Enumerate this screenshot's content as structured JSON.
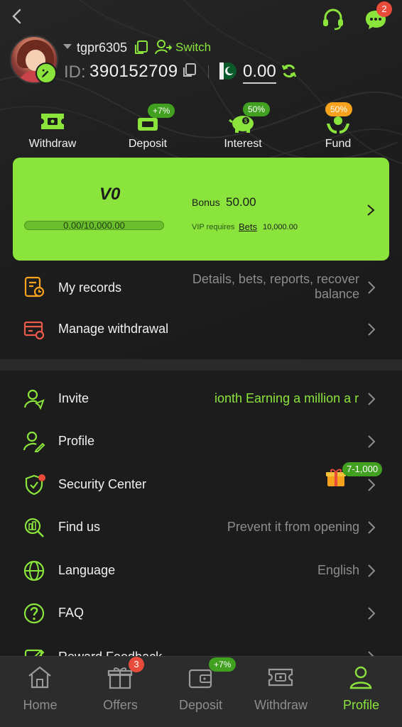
{
  "header": {
    "back_icon": "chevron-left-icon",
    "support_icon": "headset-icon",
    "messages_icon": "chat-icon",
    "messages_badge": "2",
    "username": "tgpr6305",
    "switch_label": "Switch",
    "id_label": "ID:",
    "user_id": "390152709",
    "balance": "0.00",
    "flag_icon": "pakistan-flag-icon",
    "refresh_icon": "refresh-icon"
  },
  "quick_actions": [
    {
      "label": "Withdraw",
      "icon": "withdraw-ticket-icon",
      "badge": ""
    },
    {
      "label": "Deposit",
      "icon": "deposit-icon",
      "badge": "+7%"
    },
    {
      "label": "Interest",
      "icon": "piggy-bank-icon",
      "badge": "50%"
    },
    {
      "label": "Fund",
      "icon": "fund-hands-icon",
      "badge": "50%"
    }
  ],
  "vip": {
    "level": "V0",
    "progress_text": "0.00/10,000.00",
    "progress_fraction": 0.0,
    "bonus_label": "Bonus",
    "bonus_value": "50.00",
    "requires_label": "VIP requires",
    "bets_label": "Bets",
    "requires_amount": "10,000.00"
  },
  "menu_top": [
    {
      "label": "My records",
      "value_line1": "Details, bets, reports, recover",
      "value_line2": "balance",
      "icon": "records-icon"
    },
    {
      "label": "Manage withdrawal",
      "value_line1": "",
      "value_line2": "",
      "icon": "manage-withdrawal-icon"
    }
  ],
  "menu_bottom": [
    {
      "label": "Invite",
      "value": "ionth  Earning a million a r",
      "icon": "invite-icon"
    },
    {
      "label": "Profile",
      "value": "",
      "icon": "profile-edit-icon"
    },
    {
      "label": "Security Center",
      "value": "",
      "icon": "shield-check-icon",
      "gift_badge": "7-1,000"
    },
    {
      "label": "Find us",
      "value": "Prevent it from opening",
      "icon": "find-us-icon"
    },
    {
      "label": "Language",
      "value": "English",
      "icon": "globe-icon"
    },
    {
      "label": "FAQ",
      "value": "",
      "icon": "question-icon"
    },
    {
      "label": "Reward Feedback",
      "value": "",
      "icon": "feedback-icon"
    }
  ],
  "bottom_nav": [
    {
      "label": "Home",
      "icon": "home-icon",
      "badge": ""
    },
    {
      "label": "Offers",
      "icon": "gift-box-icon",
      "badge": "3"
    },
    {
      "label": "Deposit",
      "icon": "wallet-icon",
      "badge": "+7%"
    },
    {
      "label": "Withdraw",
      "icon": "withdraw-ticket-icon",
      "badge": ""
    },
    {
      "label": "Profile",
      "icon": "user-icon",
      "badge": ""
    }
  ],
  "colors": {
    "accent": "#8be43c",
    "background": "#1c1c1c",
    "badge_red": "#e84b3a",
    "badge_orange": "#f6a21d"
  }
}
